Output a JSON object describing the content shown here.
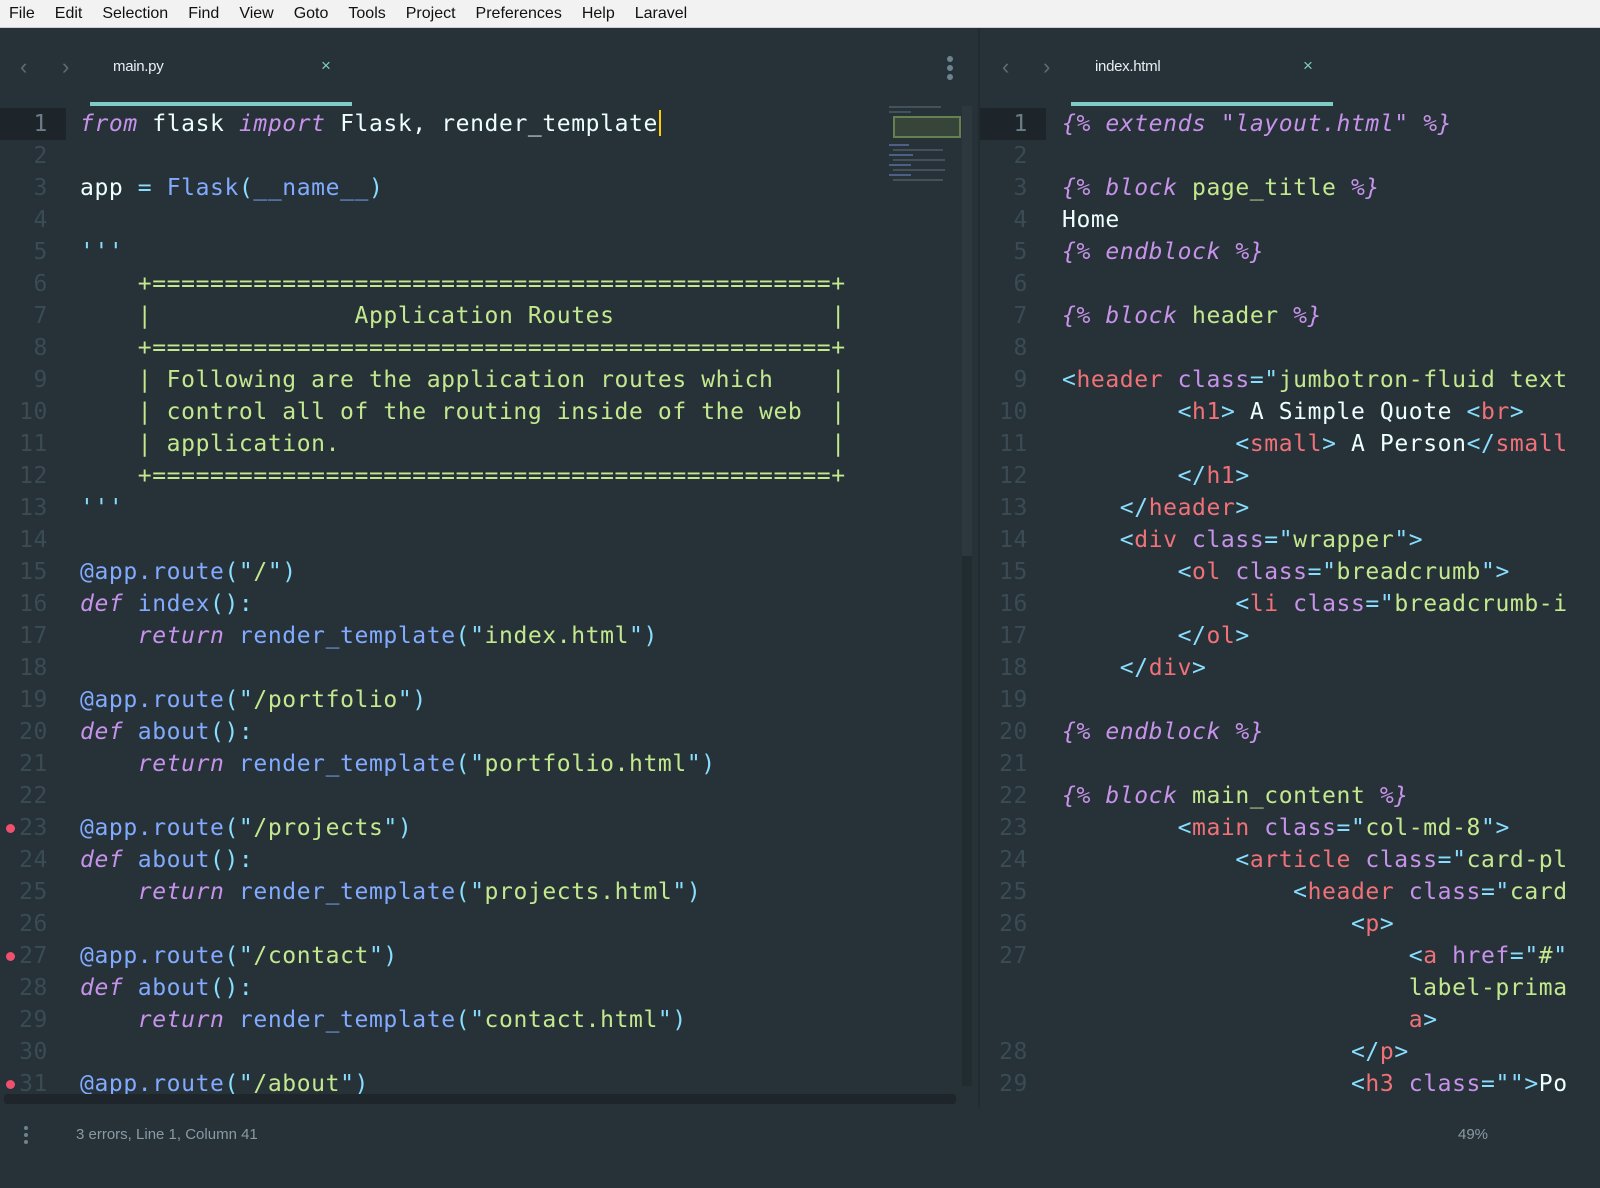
{
  "menu": [
    "File",
    "Edit",
    "Selection",
    "Find",
    "View",
    "Goto",
    "Tools",
    "Project",
    "Preferences",
    "Help",
    "Laravel"
  ],
  "left_pane": {
    "tab": {
      "title": "main.py",
      "close": "×"
    },
    "nav_back": "‹",
    "nav_forward": "›",
    "lines": [
      {
        "n": "1",
        "current": true,
        "tokens": [
          [
            "kw",
            "from"
          ],
          [
            "pl",
            " flask "
          ],
          [
            "kw",
            "import"
          ],
          [
            "pl",
            " Flask, render_template"
          ]
        ],
        "caret": true
      },
      {
        "n": "2",
        "tokens": []
      },
      {
        "n": "3",
        "tokens": [
          [
            "pl",
            "app "
          ],
          [
            "pn",
            "="
          ],
          [
            "fn",
            " Flask"
          ],
          [
            "pn",
            "("
          ],
          [
            "fn",
            "__name__"
          ],
          [
            "pn",
            ")"
          ]
        ]
      },
      {
        "n": "4",
        "tokens": []
      },
      {
        "n": "5",
        "tokens": [
          [
            "pn",
            "'''"
          ]
        ]
      },
      {
        "n": "6",
        "tokens": [
          [
            "cm",
            "    +===============================================+"
          ]
        ]
      },
      {
        "n": "7",
        "tokens": [
          [
            "cm",
            "    |              Application Routes               |"
          ]
        ]
      },
      {
        "n": "8",
        "tokens": [
          [
            "cm",
            "    +===============================================+"
          ]
        ]
      },
      {
        "n": "9",
        "tokens": [
          [
            "cm",
            "    | Following are the application routes which    |"
          ]
        ]
      },
      {
        "n": "10",
        "tokens": [
          [
            "cm",
            "    | control all of the routing inside of the web  |"
          ]
        ]
      },
      {
        "n": "11",
        "tokens": [
          [
            "cm",
            "    | application.                                  |"
          ]
        ]
      },
      {
        "n": "12",
        "tokens": [
          [
            "cm",
            "    +===============================================+"
          ]
        ]
      },
      {
        "n": "13",
        "tokens": [
          [
            "pn",
            "'''"
          ]
        ]
      },
      {
        "n": "14",
        "tokens": []
      },
      {
        "n": "15",
        "tokens": [
          [
            "dec",
            "@app.route"
          ],
          [
            "pn",
            "(\""
          ],
          [
            "str",
            "/"
          ],
          [
            "pn",
            "\")"
          ]
        ]
      },
      {
        "n": "16",
        "tokens": [
          [
            "kw",
            "def"
          ],
          [
            "fn",
            " index"
          ],
          [
            "pn",
            "():"
          ]
        ]
      },
      {
        "n": "17",
        "tokens": [
          [
            "pl",
            "    "
          ],
          [
            "kw",
            "return"
          ],
          [
            "fn",
            " render_template"
          ],
          [
            "pn",
            "(\""
          ],
          [
            "str",
            "index.html"
          ],
          [
            "pn",
            "\")"
          ]
        ]
      },
      {
        "n": "18",
        "tokens": []
      },
      {
        "n": "19",
        "tokens": [
          [
            "dec",
            "@app.route"
          ],
          [
            "pn",
            "(\""
          ],
          [
            "str",
            "/portfolio"
          ],
          [
            "pn",
            "\")"
          ]
        ]
      },
      {
        "n": "20",
        "tokens": [
          [
            "kw",
            "def"
          ],
          [
            "fn",
            " about"
          ],
          [
            "pn",
            "():"
          ]
        ]
      },
      {
        "n": "21",
        "tokens": [
          [
            "pl",
            "    "
          ],
          [
            "kw",
            "return"
          ],
          [
            "fn",
            " render_template"
          ],
          [
            "pn",
            "(\""
          ],
          [
            "str",
            "portfolio.html"
          ],
          [
            "pn",
            "\")"
          ]
        ]
      },
      {
        "n": "22",
        "tokens": []
      },
      {
        "n": "23",
        "error": true,
        "tokens": [
          [
            "dec",
            "@app.route"
          ],
          [
            "pn",
            "(\""
          ],
          [
            "str",
            "/projects"
          ],
          [
            "pn",
            "\")"
          ]
        ]
      },
      {
        "n": "24",
        "tokens": [
          [
            "kw",
            "def"
          ],
          [
            "fn",
            " about"
          ],
          [
            "pn",
            "():"
          ]
        ]
      },
      {
        "n": "25",
        "tokens": [
          [
            "pl",
            "    "
          ],
          [
            "kw",
            "return"
          ],
          [
            "fn",
            " render_template"
          ],
          [
            "pn",
            "(\""
          ],
          [
            "str",
            "projects.html"
          ],
          [
            "pn",
            "\")"
          ]
        ]
      },
      {
        "n": "26",
        "tokens": []
      },
      {
        "n": "27",
        "error": true,
        "tokens": [
          [
            "dec",
            "@app.route"
          ],
          [
            "pn",
            "(\""
          ],
          [
            "str",
            "/contact"
          ],
          [
            "pn",
            "\")"
          ]
        ]
      },
      {
        "n": "28",
        "tokens": [
          [
            "kw",
            "def"
          ],
          [
            "fn",
            " about"
          ],
          [
            "pn",
            "():"
          ]
        ]
      },
      {
        "n": "29",
        "tokens": [
          [
            "pl",
            "    "
          ],
          [
            "kw",
            "return"
          ],
          [
            "fn",
            " render_template"
          ],
          [
            "pn",
            "(\""
          ],
          [
            "str",
            "contact.html"
          ],
          [
            "pn",
            "\")"
          ]
        ]
      },
      {
        "n": "30",
        "tokens": []
      },
      {
        "n": "31",
        "error": true,
        "tokens": [
          [
            "dec",
            "@app.route"
          ],
          [
            "pn",
            "(\""
          ],
          [
            "str",
            "/about"
          ],
          [
            "pn",
            "\")"
          ]
        ]
      }
    ]
  },
  "right_pane": {
    "tab": {
      "title": "index.html",
      "close": "×"
    },
    "nav_back": "‹",
    "nav_forward": "›",
    "lines": [
      {
        "n": "1",
        "current": true,
        "tokens": [
          [
            "tpl",
            "{% extends "
          ],
          [
            "tpl",
            "\"layout.html\""
          ],
          [
            "tpl",
            " %}"
          ]
        ]
      },
      {
        "n": "2",
        "tokens": []
      },
      {
        "n": "3",
        "tokens": [
          [
            "tpl",
            "{% block "
          ],
          [
            "tplname",
            "page_title"
          ],
          [
            "tpl",
            " %}"
          ]
        ]
      },
      {
        "n": "4",
        "tokens": [
          [
            "pl",
            "Home"
          ]
        ]
      },
      {
        "n": "5",
        "tokens": [
          [
            "tpl",
            "{% endblock %}"
          ]
        ]
      },
      {
        "n": "6",
        "tokens": []
      },
      {
        "n": "7",
        "tokens": [
          [
            "tpl",
            "{% block "
          ],
          [
            "tplname",
            "header"
          ],
          [
            "tpl",
            " %}"
          ]
        ]
      },
      {
        "n": "8",
        "tokens": []
      },
      {
        "n": "9",
        "tokens": [
          [
            "pn",
            "<"
          ],
          [
            "tag",
            "header"
          ],
          [
            "attr",
            " class"
          ],
          [
            "pn",
            "=\""
          ],
          [
            "str",
            "jumbotron-fluid text"
          ]
        ]
      },
      {
        "n": "10",
        "tokens": [
          [
            "pl",
            "        "
          ],
          [
            "pn",
            "<"
          ],
          [
            "tag",
            "h1"
          ],
          [
            "pn",
            ">"
          ],
          [
            "pl",
            " A Simple Quote "
          ],
          [
            "pn",
            "<"
          ],
          [
            "tag",
            "br"
          ],
          [
            "pn",
            ">"
          ]
        ]
      },
      {
        "n": "11",
        "tokens": [
          [
            "pl",
            "            "
          ],
          [
            "pn",
            "<"
          ],
          [
            "tag",
            "small"
          ],
          [
            "pn",
            ">"
          ],
          [
            "pl",
            " A Person"
          ],
          [
            "pn",
            "</"
          ],
          [
            "tag",
            "small"
          ]
        ]
      },
      {
        "n": "12",
        "tokens": [
          [
            "pl",
            "        "
          ],
          [
            "pn",
            "</"
          ],
          [
            "tag",
            "h1"
          ],
          [
            "pn",
            ">"
          ]
        ]
      },
      {
        "n": "13",
        "tokens": [
          [
            "pl",
            "    "
          ],
          [
            "pn",
            "</"
          ],
          [
            "tag",
            "header"
          ],
          [
            "pn",
            ">"
          ]
        ]
      },
      {
        "n": "14",
        "tokens": [
          [
            "pl",
            "    "
          ],
          [
            "pn",
            "<"
          ],
          [
            "tag",
            "div"
          ],
          [
            "attr",
            " class"
          ],
          [
            "pn",
            "=\""
          ],
          [
            "str",
            "wrapper"
          ],
          [
            "pn",
            "\">"
          ]
        ]
      },
      {
        "n": "15",
        "tokens": [
          [
            "pl",
            "        "
          ],
          [
            "pn",
            "<"
          ],
          [
            "tag",
            "ol"
          ],
          [
            "attr",
            " class"
          ],
          [
            "pn",
            "=\""
          ],
          [
            "str",
            "breadcrumb"
          ],
          [
            "pn",
            "\">"
          ]
        ]
      },
      {
        "n": "16",
        "tokens": [
          [
            "pl",
            "            "
          ],
          [
            "pn",
            "<"
          ],
          [
            "tag",
            "li"
          ],
          [
            "attr",
            " class"
          ],
          [
            "pn",
            "=\""
          ],
          [
            "str",
            "breadcrumb-i"
          ]
        ]
      },
      {
        "n": "17",
        "tokens": [
          [
            "pl",
            "        "
          ],
          [
            "pn",
            "</"
          ],
          [
            "tag",
            "ol"
          ],
          [
            "pn",
            ">"
          ]
        ]
      },
      {
        "n": "18",
        "tokens": [
          [
            "pl",
            "    "
          ],
          [
            "pn",
            "</"
          ],
          [
            "tag",
            "div"
          ],
          [
            "pn",
            ">"
          ]
        ]
      },
      {
        "n": "19",
        "tokens": []
      },
      {
        "n": "20",
        "tokens": [
          [
            "tpl",
            "{% endblock %}"
          ]
        ]
      },
      {
        "n": "21",
        "tokens": []
      },
      {
        "n": "22",
        "tokens": [
          [
            "tpl",
            "{% block "
          ],
          [
            "tplname",
            "main_content"
          ],
          [
            "tpl",
            " %}"
          ]
        ]
      },
      {
        "n": "23",
        "tokens": [
          [
            "pl",
            "        "
          ],
          [
            "pn",
            "<"
          ],
          [
            "tag",
            "main"
          ],
          [
            "attr",
            " class"
          ],
          [
            "pn",
            "=\""
          ],
          [
            "str",
            "col-md-8"
          ],
          [
            "pn",
            "\">"
          ]
        ]
      },
      {
        "n": "24",
        "tokens": [
          [
            "pl",
            "            "
          ],
          [
            "pn",
            "<"
          ],
          [
            "tag",
            "article"
          ],
          [
            "attr",
            " class"
          ],
          [
            "pn",
            "=\""
          ],
          [
            "str",
            "card-pl"
          ]
        ]
      },
      {
        "n": "25",
        "tokens": [
          [
            "pl",
            "                "
          ],
          [
            "pn",
            "<"
          ],
          [
            "tag",
            "header"
          ],
          [
            "attr",
            " class"
          ],
          [
            "pn",
            "=\""
          ],
          [
            "str",
            "card"
          ]
        ]
      },
      {
        "n": "26",
        "tokens": [
          [
            "pl",
            "                    "
          ],
          [
            "pn",
            "<"
          ],
          [
            "tag",
            "p"
          ],
          [
            "pn",
            ">"
          ]
        ]
      },
      {
        "n": "27",
        "tokens": [
          [
            "pl",
            "                        "
          ],
          [
            "pn",
            "<"
          ],
          [
            "tag",
            "a"
          ],
          [
            "attr",
            " href"
          ],
          [
            "pn",
            "=\""
          ],
          [
            "str",
            "#"
          ],
          [
            "pn",
            "\""
          ]
        ]
      },
      {
        "n": "",
        "tokens": [
          [
            "pl",
            "                        "
          ],
          [
            "str",
            "label-prima"
          ]
        ]
      },
      {
        "n": "",
        "tokens": [
          [
            "pl",
            "                        "
          ],
          [
            "tag",
            "a"
          ],
          [
            "pn",
            ">"
          ]
        ]
      },
      {
        "n": "28",
        "tokens": [
          [
            "pl",
            "                    "
          ],
          [
            "pn",
            "</"
          ],
          [
            "tag",
            "p"
          ],
          [
            "pn",
            ">"
          ]
        ]
      },
      {
        "n": "29",
        "tokens": [
          [
            "pl",
            "                    "
          ],
          [
            "pn",
            "<"
          ],
          [
            "tag",
            "h3"
          ],
          [
            "attr",
            " class"
          ],
          [
            "pn",
            "=\"\">"
          ],
          [
            "pl",
            "Po"
          ]
        ]
      }
    ]
  },
  "status": {
    "message": "3 errors, Line 1, Column 41",
    "zoom": "49%"
  }
}
